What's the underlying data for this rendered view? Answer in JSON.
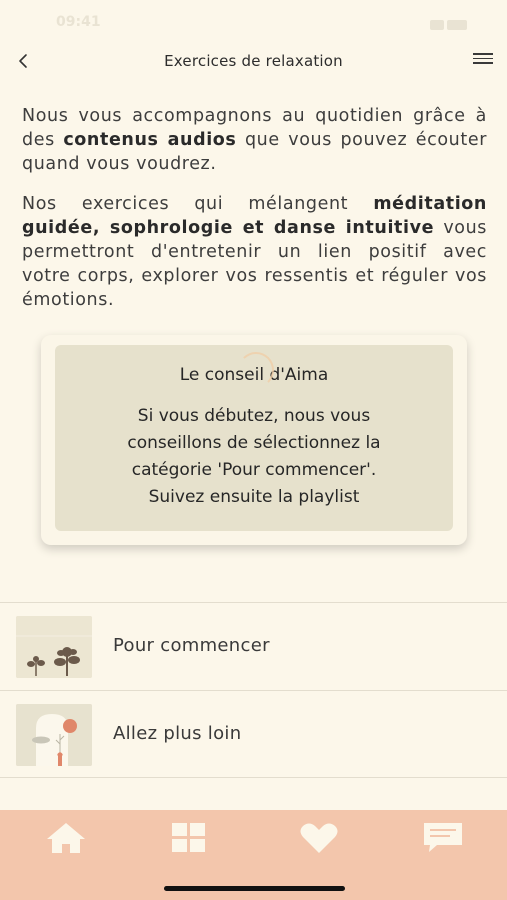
{
  "status_bar": {
    "time": "09:41"
  },
  "header": {
    "title": "Exercices de relaxation"
  },
  "intro": {
    "p1_a": "Nous vous accompagnons au quotidien grâce à des ",
    "p1_bold": "contenus audios",
    "p1_b": " que vous pouvez écouter quand vous voudrez.",
    "p2_a": "Nos exercices qui mélangent ",
    "p2_bold": "méditation guidée, sophrologie et danse intuitive",
    "p2_b": " vous permettront d'entretenir un lien positif avec votre corps, explorer vos ressentis et réguler vos émotions."
  },
  "tip": {
    "title": "Le conseil d'Aima",
    "line1": "Si vous débutez, nous vous",
    "line2": "conseillons de sélectionnez la",
    "line3": "catégorie 'Pour commencer'.",
    "line4": "Suivez ensuite la playlist"
  },
  "categories": [
    {
      "label": "Pour commencer"
    },
    {
      "label": "Allez plus loin"
    }
  ],
  "tabs": [
    {
      "icon": "home-icon"
    },
    {
      "icon": "grid-icon"
    },
    {
      "icon": "heart-icon"
    },
    {
      "icon": "chat-icon"
    }
  ],
  "colors": {
    "background": "#fcf7ea",
    "tip_background": "#e6e1cc",
    "tab_bar": "#f3c6ac",
    "tab_icons": "#fcf7ea"
  }
}
